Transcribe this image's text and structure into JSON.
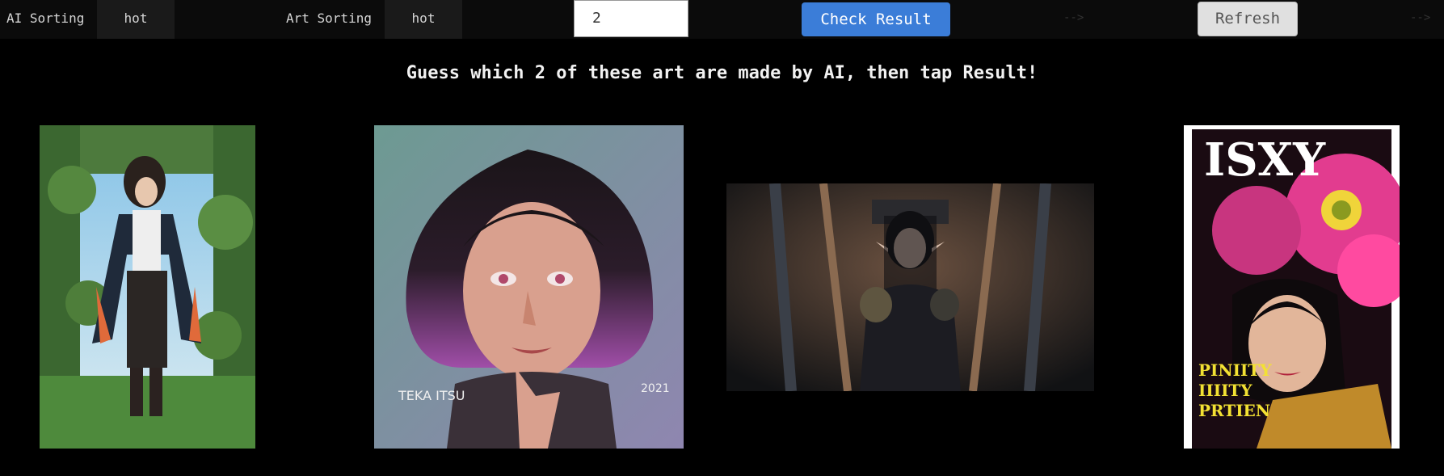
{
  "toolbar": {
    "ai_sorting_label": "AI Sorting",
    "ai_sorting_value": "hot",
    "art_sorting_label": "Art Sorting",
    "art_sorting_value": "hot",
    "count_value": "2",
    "check_label": "Check Result",
    "arrow_1": "-->",
    "refresh_label": "Refresh",
    "arrow_2": "-->"
  },
  "prompt": "Guess which 2 of these art are made by AI, then tap Result!",
  "artworks": [
    {
      "name": "artwork-1",
      "subject": "man-in-forest-portal"
    },
    {
      "name": "artwork-2",
      "subject": "girl-with-purple-bob",
      "sig_left": "TEKA ITSU",
      "sig_right": "2021"
    },
    {
      "name": "artwork-3",
      "subject": "elf-in-sci-fi-corridor"
    },
    {
      "name": "artwork-4",
      "subject": "magazine-cover-woman-with-flowers",
      "cover_title": "ISXY",
      "cover_lines": [
        "PINIITY",
        "IIIITY",
        "PRTIEN"
      ]
    }
  ],
  "colors": {
    "check_button": "#3b7dd8",
    "refresh_button": "#e0e0e0",
    "background": "#000000",
    "toolbar": "#0b0b0b"
  }
}
